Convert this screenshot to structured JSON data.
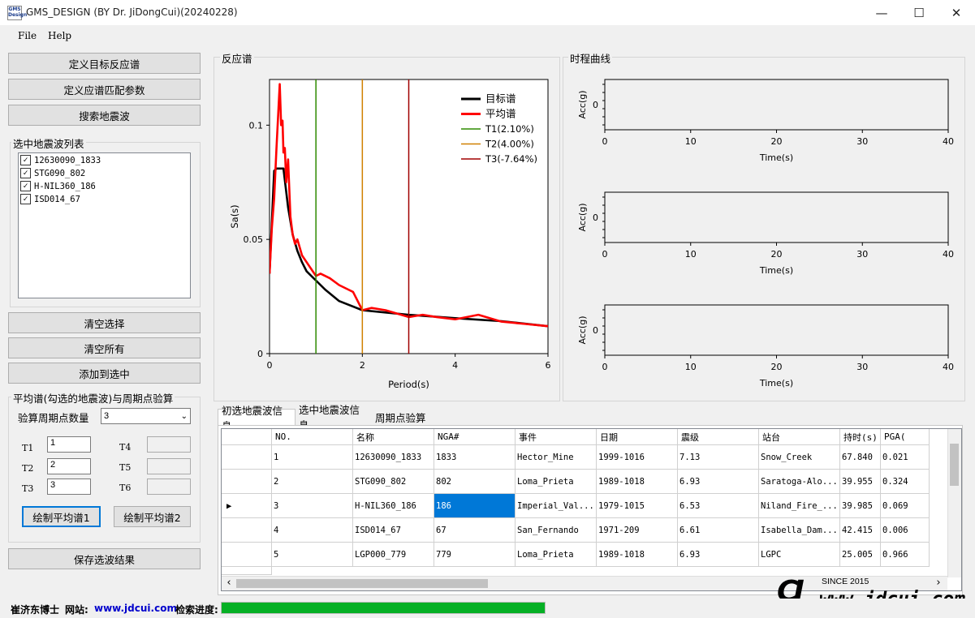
{
  "window": {
    "title": "GMS_DESIGN (BY Dr. JiDongCui)(20240228)",
    "icon_text": "GMS Design",
    "minimize_icon": "—",
    "maximize_icon": "☐",
    "close_icon": "✕"
  },
  "menu": {
    "items": [
      "File",
      "Help"
    ]
  },
  "left": {
    "btn_define_target": "定义目标反应谱",
    "btn_define_params": "定义应谱匹配参数",
    "btn_search": "搜索地震波",
    "selected_list_label": "选中地震波列表",
    "selected_list": [
      "12630090_1833",
      "STG090_802",
      "H-NIL360_186",
      "ISD014_67"
    ],
    "btn_clear_selection": "清空选择",
    "btn_clear_all": "清空所有",
    "btn_add_selected": "添加到选中",
    "avg_group_label": "平均谱(勾选的地震波)与周期点验算",
    "period_count_label": "验算周期点数量",
    "period_count_value": "3",
    "t_labels": [
      "T1",
      "T2",
      "T3",
      "T4",
      "T5",
      "T6"
    ],
    "t_values": [
      "1",
      "2",
      "3",
      "",
      "",
      ""
    ],
    "btn_plot_avg1": "绘制平均谱1",
    "btn_plot_avg2": "绘制平均谱2",
    "btn_save": "保存选波结果"
  },
  "spectrum_panel": {
    "title": "反应谱"
  },
  "history_panel": {
    "title": "时程曲线"
  },
  "chart_data": [
    {
      "type": "line",
      "title": "",
      "xlabel": "Period(s)",
      "ylabel": "Sa(s)",
      "xlim": [
        0,
        6
      ],
      "ylim": [
        0,
        0.12
      ],
      "xticks": [
        "0",
        "2",
        "4",
        "6"
      ],
      "yticks": [
        "0",
        "0.05",
        "0.1"
      ],
      "legend_position": "top-right",
      "series": [
        {
          "name": "目标谱",
          "color": "#000000",
          "x": [
            0,
            0.1,
            0.15,
            0.3,
            0.4,
            0.5,
            0.6,
            0.7,
            0.8,
            1.0,
            1.2,
            1.5,
            2.0,
            2.5,
            3.0,
            4.0,
            5.0,
            6.0
          ],
          "y": [
            0.035,
            0.08,
            0.081,
            0.081,
            0.064,
            0.052,
            0.045,
            0.04,
            0.036,
            0.032,
            0.028,
            0.023,
            0.019,
            0.018,
            0.017,
            0.0155,
            0.0142,
            0.012
          ]
        },
        {
          "name": "平均谱",
          "color": "#ff0000",
          "x": [
            0,
            0.05,
            0.1,
            0.15,
            0.2,
            0.22,
            0.25,
            0.28,
            0.3,
            0.33,
            0.36,
            0.4,
            0.45,
            0.5,
            0.55,
            0.6,
            0.7,
            0.8,
            1.0,
            1.1,
            1.3,
            1.5,
            1.7,
            1.8,
            2.0,
            2.2,
            2.5,
            3.0,
            3.3,
            3.6,
            4.0,
            4.5,
            5.0,
            5.5,
            6.0
          ],
          "y": [
            0.035,
            0.055,
            0.068,
            0.09,
            0.11,
            0.118,
            0.1,
            0.102,
            0.088,
            0.09,
            0.075,
            0.085,
            0.06,
            0.052,
            0.048,
            0.05,
            0.043,
            0.04,
            0.034,
            0.035,
            0.033,
            0.03,
            0.028,
            0.027,
            0.019,
            0.02,
            0.019,
            0.016,
            0.017,
            0.016,
            0.015,
            0.017,
            0.014,
            0.013,
            0.012
          ]
        },
        {
          "name": "T1(2.10%)",
          "color": "#2e8b00",
          "vline_x": 1
        },
        {
          "name": "T2(4.00%)",
          "color": "#d08000",
          "vline_x": 2
        },
        {
          "name": "T3(-7.64%)",
          "color": "#a00000",
          "vline_x": 3
        }
      ]
    },
    {
      "type": "line",
      "xlabel": "Time(s)",
      "ylabel": "Acc(g)",
      "xlim": [
        0,
        40
      ],
      "xticks": [
        "0",
        "10",
        "20",
        "30",
        "40"
      ],
      "yticks": [
        "0"
      ],
      "series": []
    },
    {
      "type": "line",
      "xlabel": "Time(s)",
      "ylabel": "Acc(g)",
      "xlim": [
        0,
        40
      ],
      "xticks": [
        "0",
        "10",
        "20",
        "30",
        "40"
      ],
      "yticks": [
        "0"
      ],
      "series": []
    },
    {
      "type": "line",
      "xlabel": "Time(s)",
      "ylabel": "Acc(g)",
      "xlim": [
        0,
        40
      ],
      "xticks": [
        "0",
        "10",
        "20",
        "30",
        "40"
      ],
      "yticks": [
        "0"
      ],
      "series": []
    }
  ],
  "tabs": [
    "初选地震波信息",
    "选中地震波信息",
    "周期点验算"
  ],
  "table": {
    "columns": [
      "NO.",
      "名称",
      "NGA#",
      "事件",
      "日期",
      "震级",
      "站台",
      "持时(s)",
      "PGA("
    ],
    "rows": [
      [
        "1",
        "12630090_1833",
        "1833",
        "Hector_Mine",
        "1999-1016",
        "7.13",
        "Snow_Creek",
        "67.840",
        "0.021"
      ],
      [
        "2",
        "STG090_802",
        "802",
        "Loma_Prieta",
        "1989-1018",
        "6.93",
        "Saratoga-Alo...",
        "39.955",
        "0.324"
      ],
      [
        "3",
        "H-NIL360_186",
        "186",
        "Imperial_Val...",
        "1979-1015",
        "6.53",
        "Niland_Fire_...",
        "39.985",
        "0.069"
      ],
      [
        "4",
        "ISD014_67",
        "67",
        "San_Fernando",
        "1971-209",
        "6.61",
        "Isabella_Dam...",
        "42.415",
        "0.006"
      ],
      [
        "5",
        "LGP000_779",
        "779",
        "Loma_Prieta",
        "1989-1018",
        "6.93",
        "LGPC",
        "25.005",
        "0.966"
      ]
    ],
    "current_row_marker": "▶",
    "scroll_left": "‹",
    "scroll_right": "›"
  },
  "watermark": {
    "logo": "CJ",
    "since": "SINCE 2015",
    "site": "www.jdcui.com"
  },
  "status": {
    "author": "崔济东博士",
    "site_label": "网站:",
    "site_url": "www.jdcui.com",
    "progress_label": "检索进度:",
    "progress": 1.0,
    "progress_color": "#06b025"
  }
}
